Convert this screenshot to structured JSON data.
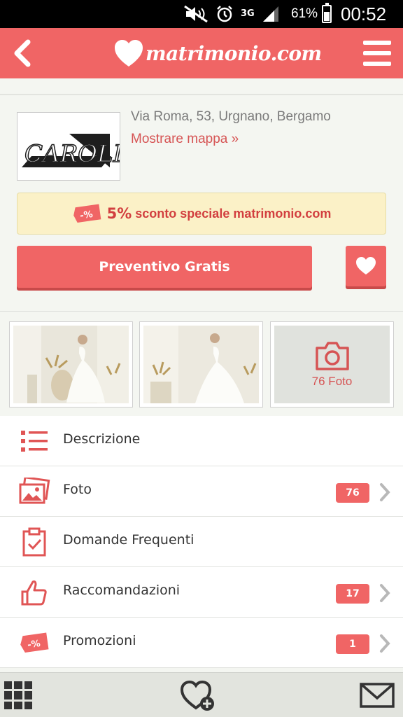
{
  "status_bar": {
    "network": "3G",
    "battery": "61%",
    "time": "00:52"
  },
  "header": {
    "logo_text": "matrimonio.com",
    "back_icon": "chevron-left-icon",
    "menu_icon": "hamburger-menu-icon"
  },
  "vendor": {
    "logo_text": "CAROLI",
    "address": "Via Roma, 53, Urgnano, Bergamo",
    "map_link": "Mostrare mappa »"
  },
  "promo": {
    "percent": "5%",
    "text": "sconto speciale matrimonio.com",
    "icon": "discount-tag-icon"
  },
  "actions": {
    "quote_label": "Preventivo Gratis",
    "favorite_icon": "heart-icon"
  },
  "photos": {
    "more_label": "76 Foto",
    "more_icon": "camera-icon"
  },
  "menu": [
    {
      "label": "Descrizione",
      "icon": "list-icon",
      "count": null
    },
    {
      "label": "Foto",
      "icon": "photos-icon",
      "count": "76"
    },
    {
      "label": "Domande Frequenti",
      "icon": "clipboard-check-icon",
      "count": null
    },
    {
      "label": "Raccomandazioni",
      "icon": "thumbs-up-icon",
      "count": "17"
    },
    {
      "label": "Promozioni",
      "icon": "discount-tag-icon",
      "count": "1"
    }
  ],
  "bottom_nav": {
    "items": [
      "grid-menu-icon",
      "heart-add-icon",
      "mail-icon"
    ]
  },
  "colors": {
    "brand": "#f06565",
    "brand_dark": "#c84a4a",
    "link": "#d65454",
    "promo_bg": "#fbf1c7",
    "background": "#f4f6f1"
  }
}
